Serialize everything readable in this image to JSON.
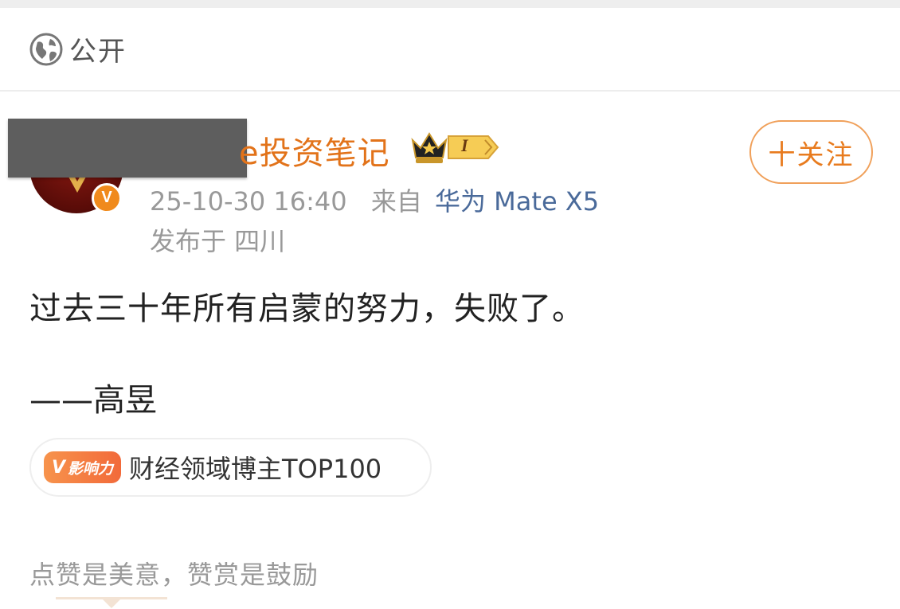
{
  "visibility": {
    "label": "公开",
    "icon": "globe-icon"
  },
  "author": {
    "name_visible": "e投资笔记",
    "verified_badge": "V",
    "level_badge": "I",
    "follow_label": "十关注"
  },
  "post_meta": {
    "timestamp": "25-10-30 16:40",
    "from_label": "来自",
    "device": "华为 Mate X5",
    "location": "发布于 四川"
  },
  "content": {
    "body": "过去三十年所有启蒙的努力，失败了。",
    "author_line": "——高昱"
  },
  "influence": {
    "pill_v": "V",
    "pill_label": "影响力",
    "tag_label": "财经领域博主TOP100"
  },
  "reward": {
    "text": "点赞是美意，赞赏是鼓励"
  },
  "colors": {
    "accent_orange": "#e87b1e",
    "device_blue": "#4a6a9a",
    "meta_gray": "#999999"
  }
}
